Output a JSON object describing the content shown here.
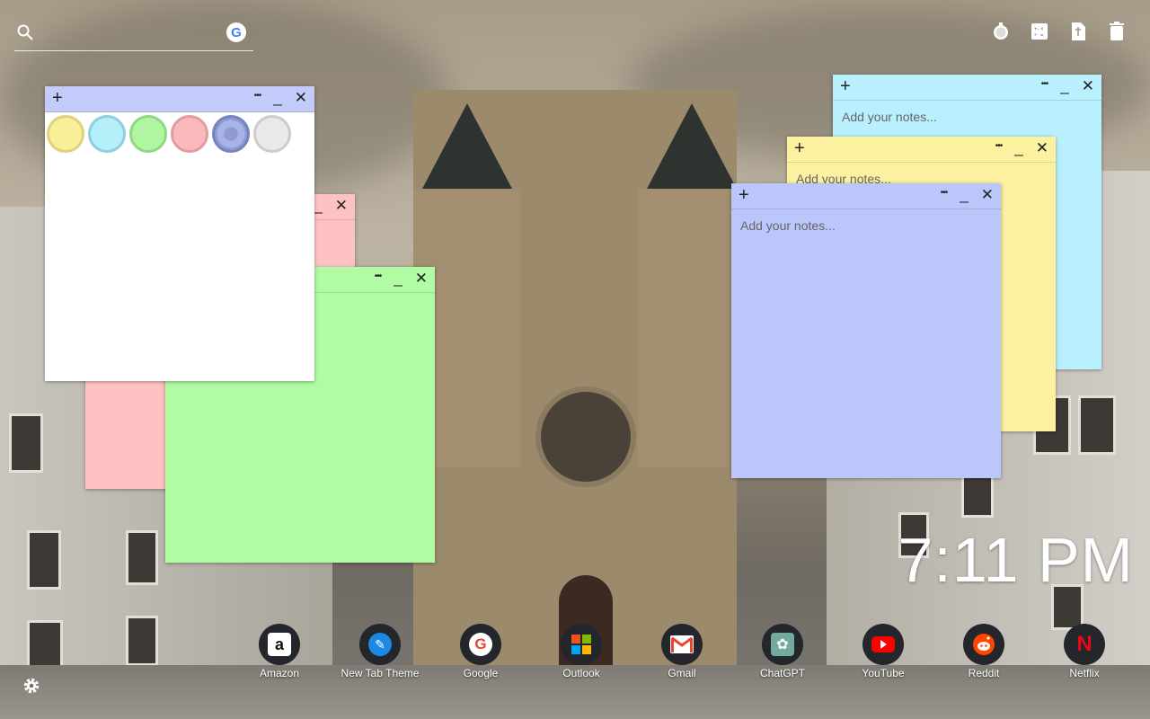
{
  "search": {
    "placeholder": "",
    "engine_icon": "google-icon"
  },
  "top_icons": [
    "timer-icon",
    "calculator-icon",
    "bookmark-icon",
    "trash-icon"
  ],
  "notes": {
    "white_note": {
      "color": "#ffffff",
      "swatches": [
        "#f9ef9a",
        "#b4effa",
        "#b0f5a2",
        "#fbb9bb",
        "#8e9bd4",
        "#e9e9e9"
      ]
    },
    "pink_note": {
      "color": "#ffc2c2"
    },
    "green_note": {
      "color": "#b2fba5"
    },
    "cyan_note": {
      "color": "#b8f1fd",
      "placeholder": "Add your notes..."
    },
    "yellow_note": {
      "color": "#fcf1a0",
      "placeholder": "Add your notes..."
    },
    "blue_note": {
      "color": "#bbc7fb",
      "placeholder": "Add your notes..."
    },
    "menu_glyph": "•••",
    "minimize_glyph": "_",
    "close_glyph": "✕",
    "add_glyph": "+"
  },
  "clock": {
    "time": "7:11 PM"
  },
  "dock": [
    {
      "label": "Amazon",
      "icon": "amazon-icon"
    },
    {
      "label": "New Tab Theme",
      "icon": "new-tab-theme-icon"
    },
    {
      "label": "Google",
      "icon": "google-icon"
    },
    {
      "label": "Outlook",
      "icon": "outlook-icon"
    },
    {
      "label": "Gmail",
      "icon": "gmail-icon"
    },
    {
      "label": "ChatGPT",
      "icon": "chatgpt-icon"
    },
    {
      "label": "YouTube",
      "icon": "youtube-icon"
    },
    {
      "label": "Reddit",
      "icon": "reddit-icon"
    },
    {
      "label": "Netflix",
      "icon": "netflix-icon"
    }
  ]
}
